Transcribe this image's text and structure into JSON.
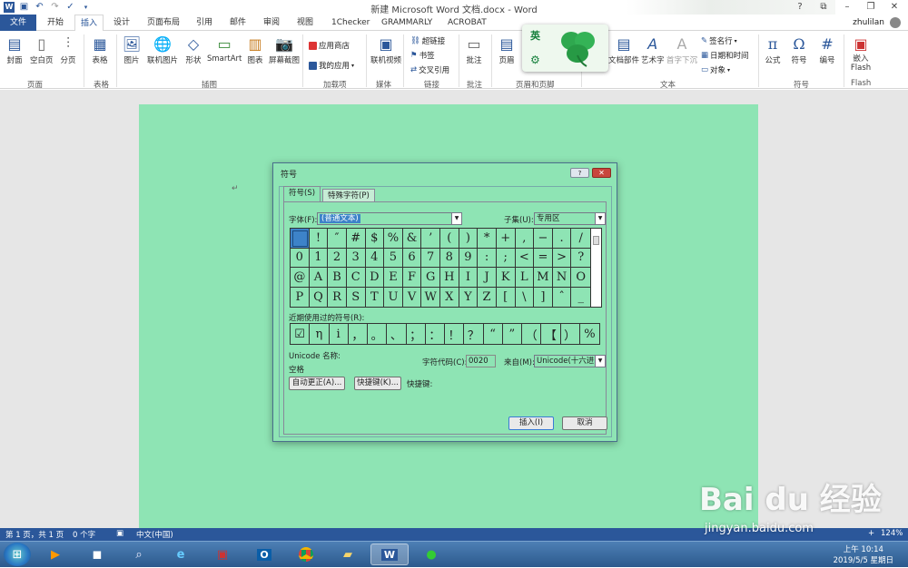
{
  "title": "新建 Microsoft Word 文档.docx - Word",
  "user": "zhulilan",
  "tabs": [
    "文件",
    "开始",
    "插入",
    "设计",
    "页面布局",
    "引用",
    "邮件",
    "审阅",
    "视图",
    "1Checker",
    "GRAMMARLY",
    "ACROBAT"
  ],
  "ribbon": {
    "pages": {
      "cover": "封面",
      "blank": "空白页",
      "break": "分页",
      "label": "页面"
    },
    "table": {
      "btn": "表格",
      "label": "表格"
    },
    "illustrations": {
      "picture": "图片",
      "online": "联机图片",
      "shapes": "形状",
      "smartart": "SmartArt",
      "chart": "图表",
      "screenshot": "屏幕截图",
      "label": "插图"
    },
    "addins": {
      "store": "应用商店",
      "myapps": "我的应用",
      "label": "加载项"
    },
    "media": {
      "video": "联机视频",
      "label": "媒体"
    },
    "links": {
      "hyperlink": "超链接",
      "bookmark": "书签",
      "crossref": "交叉引用",
      "label": "链接"
    },
    "comments": {
      "btn": "批注",
      "label": "批注"
    },
    "headerfooter": {
      "header": "页眉",
      "label": "页眉和页脚"
    },
    "text": {
      "parts": "文档部件",
      "wordart": "艺术字",
      "dropcap": "首字下沉",
      "sigline": "签名行",
      "datetime": "日期和时间",
      "object": "对象",
      "label": "文本"
    },
    "symbols": {
      "equation": "公式",
      "symbol": "符号",
      "number": "编号",
      "label": "符号"
    },
    "flash": {
      "btn": "嵌入Flash",
      "label": "Flash"
    }
  },
  "ime": {
    "lang": "英"
  },
  "dialog": {
    "title": "符号",
    "help": "?",
    "tab_symbols": "符号(S)",
    "tab_special": "特殊字符(P)",
    "font_label": "字体(F):",
    "font_value": "(普通文本)",
    "subset_label": "子集(U):",
    "subset_value": "专用区",
    "symbols": [
      " ",
      "!",
      "″",
      "#",
      "$",
      "%",
      "&",
      "’",
      "(",
      ")",
      "*",
      "+",
      ",",
      "−",
      ".",
      "/",
      "0",
      "1",
      "2",
      "3",
      "4",
      "5",
      "6",
      "7",
      "8",
      "9",
      ":",
      ";",
      "<",
      "=",
      ">",
      "?",
      "@",
      "A",
      "B",
      "C",
      "D",
      "E",
      "F",
      "G",
      "H",
      "I",
      "J",
      "K",
      "L",
      "M",
      "N",
      "O",
      "P",
      "Q",
      "R",
      "S",
      "T",
      "U",
      "V",
      "W",
      "X",
      "Y",
      "Z",
      "[",
      "\\",
      "]",
      "ˆ",
      "_"
    ],
    "recent_label": "近期使用过的符号(R):",
    "recent": [
      "☑",
      "η",
      "i",
      "，",
      "。",
      "、",
      "；",
      "：",
      "！",
      "？",
      "“",
      "”",
      "（",
      "【",
      "）",
      "%"
    ],
    "unicode_name_label": "Unicode 名称:",
    "unicode_name": "空格",
    "charcode_label": "字符代码(C):",
    "charcode": "0020",
    "from_label": "来自(M):",
    "from_value": "Unicode(十六进",
    "autocorrect": "自动更正(A)...",
    "shortcut_btn": "快捷键(K)...",
    "shortcut_label": "快捷键:",
    "insert": "插入(I)",
    "cancel": "取消"
  },
  "status": {
    "page": "第 1 页，共 1 页",
    "words": "0 个字",
    "lang": "中文(中国)",
    "zoom": "124%"
  },
  "clock": {
    "time": "上午 10:14",
    "date": "2019/5/5 星期日"
  },
  "watermark": {
    "text": "Bai du 经验",
    "url": "jingyan.baidu.com"
  }
}
